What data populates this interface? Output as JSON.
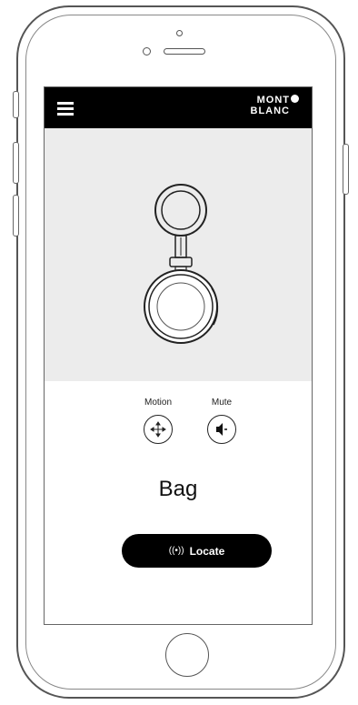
{
  "app": {
    "brand_logo_text": "MONT BLANC",
    "brand_logo_line1": "MONT",
    "brand_logo_line2": "BLANC"
  },
  "controls": {
    "motion_label": "Motion",
    "mute_label": "Mute"
  },
  "device": {
    "name": "Bag"
  },
  "actions": {
    "locate_icon": "((•))",
    "locate_label": "Locate"
  },
  "icons": {
    "menu": "hamburger-icon",
    "motion": "move-arrows-icon",
    "mute": "speaker-icon",
    "locate": "signal-icon"
  },
  "colors": {
    "appbar": "#000000",
    "hero_background": "#ececec",
    "button": "#000000",
    "button_text": "#ffffff"
  }
}
